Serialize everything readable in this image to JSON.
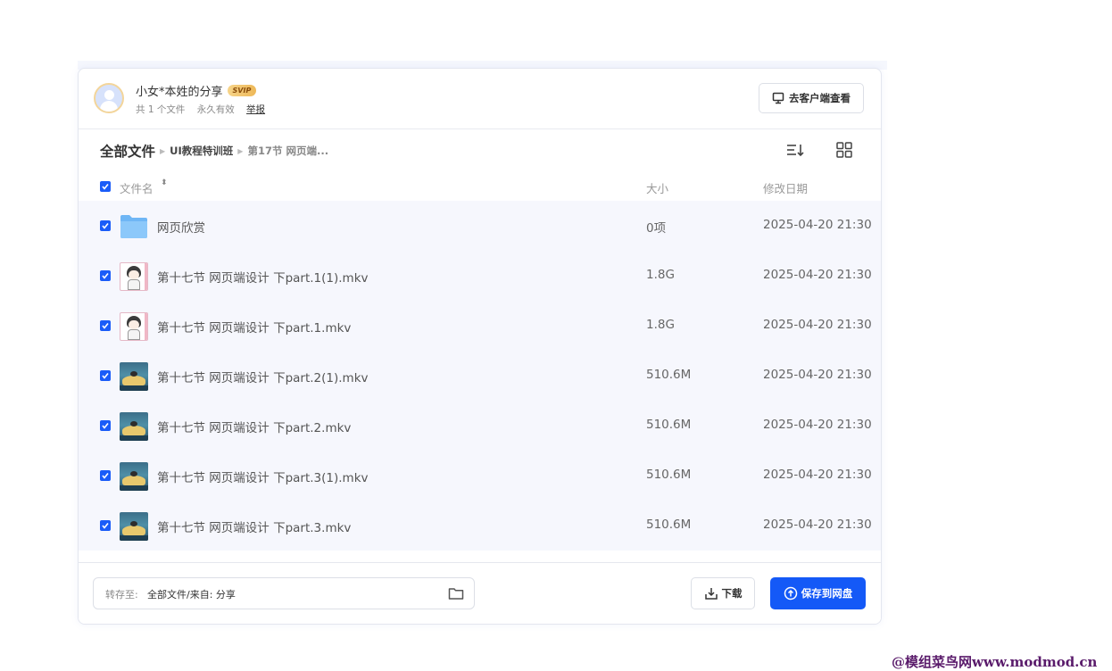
{
  "share": {
    "owner_title": "小女*本姓的分享",
    "badge": "SVIP",
    "file_count": "共 1 个文件",
    "validity": "永久有效",
    "report_label": "举报",
    "client_button": "去客户端查看"
  },
  "breadcrumb": {
    "root": "全部文件",
    "level1": "UI教程特训班",
    "level2": "第17节 网页端..."
  },
  "columns": {
    "name": "文件名",
    "size": "大小",
    "date": "修改日期"
  },
  "files": [
    {
      "name": "网页欣赏",
      "size": "0项",
      "date": "2025-04-20 21:30",
      "thumb": "folder-icon"
    },
    {
      "name": "第十七节 网页端设计 下part.1(1).mkv",
      "size": "1.8G",
      "date": "2025-04-20 21:30",
      "thumb": "girl-thumbnail"
    },
    {
      "name": "第十七节 网页端设计 下part.1.mkv",
      "size": "1.8G",
      "date": "2025-04-20 21:30",
      "thumb": "girl-thumbnail"
    },
    {
      "name": "第十七节 网页端设计 下part.2(1).mkv",
      "size": "510.6M",
      "date": "2025-04-20 21:30",
      "thumb": "scene-thumbnail"
    },
    {
      "name": "第十七节 网页端设计 下part.2.mkv",
      "size": "510.6M",
      "date": "2025-04-20 21:30",
      "thumb": "scene-thumbnail"
    },
    {
      "name": "第十七节 网页端设计 下part.3(1).mkv",
      "size": "510.6M",
      "date": "2025-04-20 21:30",
      "thumb": "scene-thumbnail"
    },
    {
      "name": "第十七节 网页端设计 下part.3.mkv",
      "size": "510.6M",
      "date": "2025-04-20 21:30",
      "thumb": "scene-thumbnail"
    }
  ],
  "footer": {
    "save_to_label": "转存至:",
    "save_to_path": "全部文件/来自: 分享",
    "download_button": "下载",
    "save_button": "保存到网盘"
  },
  "watermark": "@模组菜鸟网www.modmod.cn",
  "colors": {
    "accent": "#1459f7",
    "row_background": "#f6f7fd",
    "svip_gold": "#eeb858"
  }
}
